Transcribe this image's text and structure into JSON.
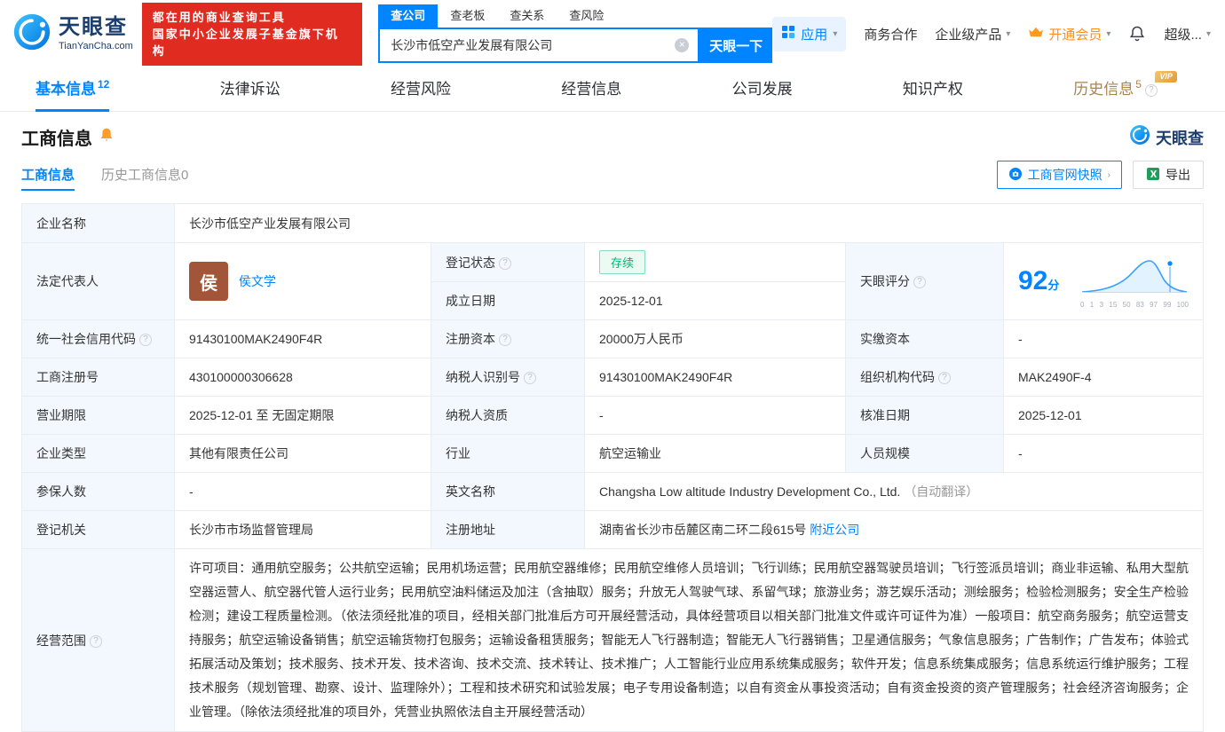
{
  "brand": {
    "name": "天眼查",
    "domain": "TianYanCha.com"
  },
  "promo": {
    "line1": "都在用的商业查询工具",
    "line2": "国家中小企业发展子基金旗下机构"
  },
  "search": {
    "tabs": [
      "查公司",
      "查老板",
      "查关系",
      "查风险"
    ],
    "value": "长沙市低空产业发展有限公司",
    "button": "天眼一下"
  },
  "top_nav": {
    "apps": "应用",
    "cooperation": "商务合作",
    "enterprise": "企业级产品",
    "vip": "开通会员",
    "more": "超级..."
  },
  "main_tabs": {
    "basic": {
      "label": "基本信息",
      "count": "12"
    },
    "legal": {
      "label": "法律诉讼"
    },
    "risk": {
      "label": "经营风险"
    },
    "operation": {
      "label": "经营信息"
    },
    "development": {
      "label": "公司发展"
    },
    "ip": {
      "label": "知识产权"
    },
    "history": {
      "label": "历史信息",
      "count": "5",
      "badge": "VIP"
    }
  },
  "section": {
    "title": "工商信息",
    "brand": "天眼查",
    "tab_current": "工商信息",
    "tab_history": "历史工商信息0",
    "snapshot_button": "工商官网快照",
    "export_button": "导出"
  },
  "info": {
    "company_name": {
      "label": "企业名称",
      "value": "长沙市低空产业发展有限公司"
    },
    "legal_rep": {
      "label": "法定代表人",
      "avatar": "侯",
      "value": "侯文学"
    },
    "reg_status": {
      "label": "登记状态",
      "value": "存续"
    },
    "establish_date": {
      "label": "成立日期",
      "value": "2025-12-01"
    },
    "score": {
      "label": "天眼评分",
      "value": "92",
      "unit": "分",
      "ticks": [
        "0",
        "1",
        "3",
        "15",
        "50",
        "83",
        "97",
        "99",
        "100"
      ]
    },
    "credit_code": {
      "label": "统一社会信用代码",
      "value": "91430100MAK2490F4R"
    },
    "reg_capital": {
      "label": "注册资本",
      "value": "20000万人民币"
    },
    "paid_capital": {
      "label": "实缴资本",
      "value": "-"
    },
    "reg_number": {
      "label": "工商注册号",
      "value": "430100000306628"
    },
    "taxpayer_id": {
      "label": "纳税人识别号",
      "value": "91430100MAK2490F4R"
    },
    "org_code": {
      "label": "组织机构代码",
      "value": "MAK2490F-4"
    },
    "business_term": {
      "label": "营业期限",
      "value": "2025-12-01 至 无固定期限"
    },
    "taxpayer_quality": {
      "label": "纳税人资质",
      "value": "-"
    },
    "approve_date": {
      "label": "核准日期",
      "value": "2025-12-01"
    },
    "company_type": {
      "label": "企业类型",
      "value": "其他有限责任公司"
    },
    "industry": {
      "label": "行业",
      "value": "航空运输业"
    },
    "staff_size": {
      "label": "人员规模",
      "value": "-"
    },
    "insured_count": {
      "label": "参保人数",
      "value": "-"
    },
    "english_name": {
      "label": "英文名称",
      "value": "Changsha Low altitude Industry Development Co., Ltd.",
      "note": "（自动翻译）"
    },
    "reg_authority": {
      "label": "登记机关",
      "value": "长沙市市场监督管理局"
    },
    "reg_address": {
      "label": "注册地址",
      "value": "湖南省长沙市岳麓区南二环二段615号",
      "link": "附近公司"
    },
    "business_scope": {
      "label": "经营范围",
      "value": "许可项目：通用航空服务；公共航空运输；民用机场运营；民用航空器维修；民用航空维修人员培训；飞行训练；民用航空器驾驶员培训；飞行签派员培训；商业非运输、私用大型航空器运营人、航空器代管人运行业务；民用航空油料储运及加注（含抽取）服务；升放无人驾驶气球、系留气球；旅游业务；游艺娱乐活动；测绘服务；检验检测服务；安全生产检验检测；建设工程质量检测。（依法须经批准的项目，经相关部门批准后方可开展经营活动，具体经营项目以相关部门批准文件或许可证件为准）一般项目：航空商务服务；航空运营支持服务；航空运输设备销售；航空运输货物打包服务；运输设备租赁服务；智能无人飞行器制造；智能无人飞行器销售；卫星通信服务；气象信息服务；广告制作；广告发布；体验式拓展活动及策划；技术服务、技术开发、技术咨询、技术交流、技术转让、技术推广；人工智能行业应用系统集成服务；软件开发；信息系统集成服务；信息系统运行维护服务；工程技术服务（规划管理、勘察、设计、监理除外）；工程和技术研究和试验发展；电子专用设备制造；以自有资金从事投资活动；自有资金投资的资产管理服务；社会经济咨询服务；企业管理。（除依法须经批准的项目外，凭营业执照依法自主开展经营活动）"
    }
  }
}
